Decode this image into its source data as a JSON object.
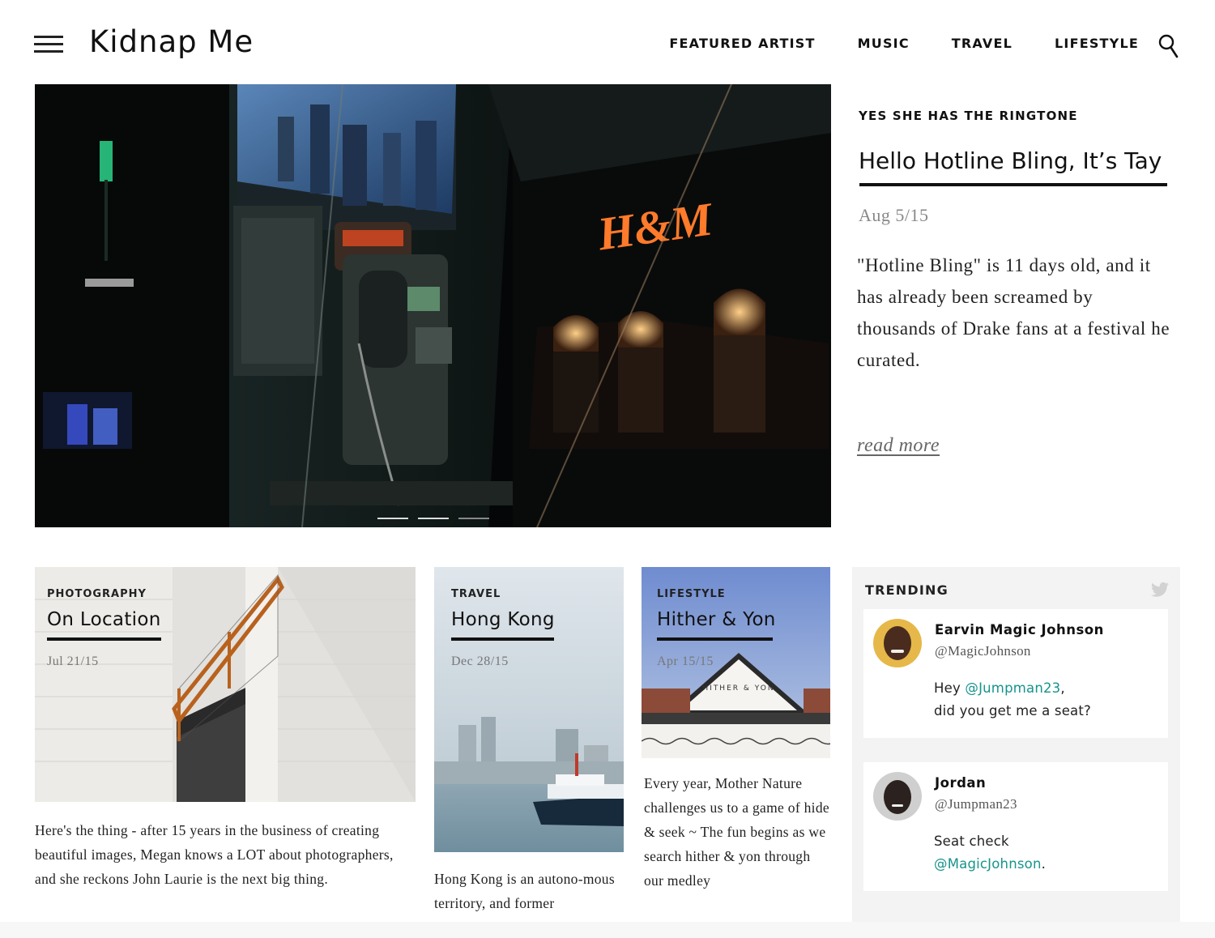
{
  "header": {
    "logo": "Kidnap Me",
    "nav": [
      "FEATURED ARTIST",
      "MUSIC",
      "TRAVEL",
      "LIFESTYLE"
    ],
    "icons": {
      "menu": "hamburger-menu-icon",
      "search": "search-icon"
    }
  },
  "hero": {
    "image": "night-payphone-photo",
    "sign_text": "H&M",
    "slide_count": 3,
    "active_slides": [
      0,
      1
    ]
  },
  "featured": {
    "kicker": "YES SHE HAS THE RINGTONE",
    "title": "Hello Hotline Bling, It’s Tay",
    "date": "Aug 5/15",
    "body": "\"Hotline Bling\" is 11 days old, and it has already been screamed by thousands of Drake fans at a festival he curated.",
    "read_more": "read more"
  },
  "cards": [
    {
      "kicker": "PHOTOGRAPHY",
      "title": "On Location",
      "date": "Jul 21/15",
      "excerpt": "Here's the thing - after 15 years in the business of creating beautiful images, Megan knows a LOT about photographers, and she reckons John Laurie is the next big thing."
    },
    {
      "kicker": "TRAVEL",
      "title": "Hong Kong",
      "date": "Dec 28/15",
      "excerpt": "Hong Kong is an autono-mous territory, and former"
    },
    {
      "kicker": "LIFESTYLE",
      "title": "Hither & Yon",
      "date": "Apr 15/15",
      "sign_text": "HITHER & YON",
      "excerpt": "Every year, Mother Nature challenges us to a game of hide & seek ~ The fun begins as we search hither & yon through our medley"
    }
  ],
  "trending": {
    "title": "TRENDING",
    "icon": "twitter-bird-icon",
    "tweets": [
      {
        "name": "Earvin Magic Johnson",
        "handle": "@MagicJohnson",
        "pre": "Hey ",
        "mention": "@Jumpman23",
        "post": ",",
        "line2": "did you get me a seat?"
      },
      {
        "name": "Jordan",
        "handle": "@Jumpman23",
        "pre": "Seat check",
        "mention": "@MagicJohnson",
        "post": "."
      }
    ]
  },
  "colors": {
    "accent": "#16948c",
    "text": "#1a1a1a",
    "muted": "#888888",
    "panel": "#f3f3f3"
  }
}
